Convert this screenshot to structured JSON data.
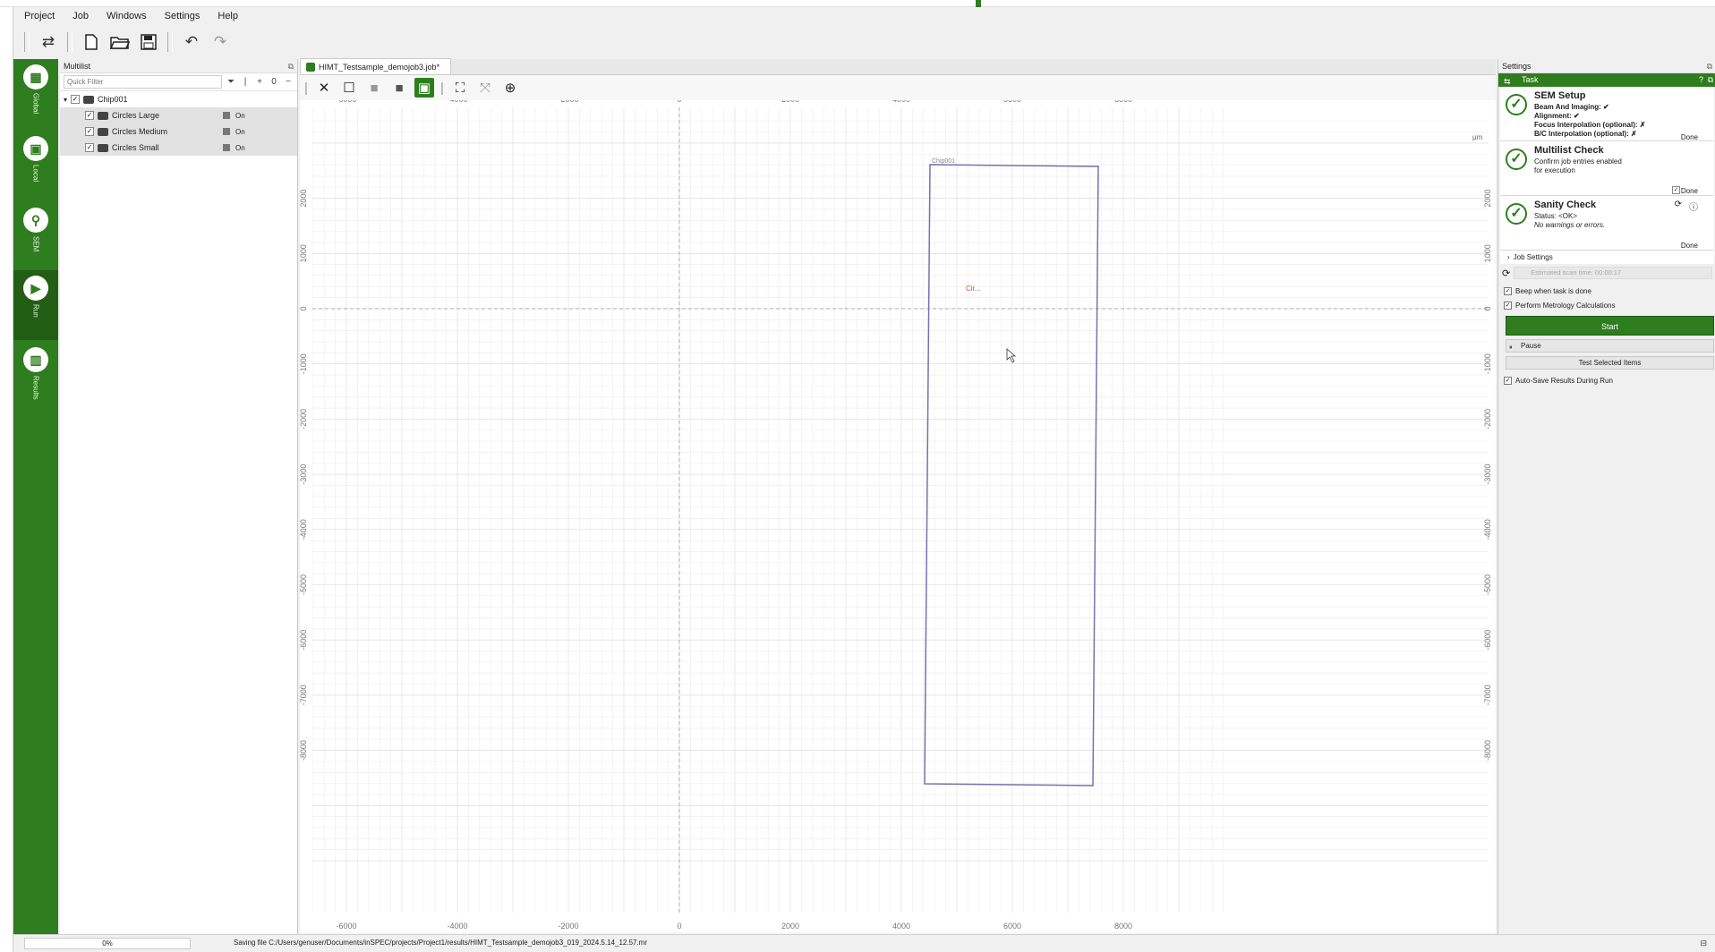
{
  "menubar": {
    "items": [
      "Project",
      "Job",
      "Windows",
      "Settings",
      "Help"
    ]
  },
  "toolbar": {
    "icons": [
      "swap-icon",
      "new-file-icon",
      "open-folder-icon",
      "save-icon",
      "undo-icon",
      "redo-icon"
    ]
  },
  "sidebar": {
    "items": [
      {
        "label": "Global",
        "icon": "global-icon"
      },
      {
        "label": "Local",
        "icon": "local-icon"
      },
      {
        "label": "SEM",
        "icon": "sem-icon"
      },
      {
        "label": "Run",
        "icon": "run-icon",
        "active": true
      },
      {
        "label": "Results",
        "icon": "results-icon"
      }
    ]
  },
  "multilist": {
    "title": "Multilist",
    "filter_placeholder": "Quick Filter",
    "counter": "0",
    "root": "Chip001",
    "items": [
      {
        "label": "Circles Large",
        "state": "On"
      },
      {
        "label": "Circles Medium",
        "state": "On"
      },
      {
        "label": "Circles Small",
        "state": "On"
      }
    ]
  },
  "job": {
    "tab_title": "HIMT_Testsample_demojob3.job*",
    "unit": "µm",
    "chip_label": "Chip001",
    "marker_label": "Cir..."
  },
  "canvas": {
    "x_ticks": [
      "-6000",
      "-4000",
      "-2000",
      "0",
      "2000",
      "4000",
      "6000",
      "8000"
    ],
    "y_ticks": [
      "2000",
      "1000",
      "0",
      "-1000",
      "-2000",
      "-3000",
      "-4000",
      "-5000",
      "-6000",
      "-7000",
      "-8000"
    ]
  },
  "settings": {
    "title": "Settings",
    "task_label": "Task",
    "sem_setup": {
      "title": "SEM Setup",
      "lines": [
        "Beam And Imaging: ✔",
        "Alignment: ✔",
        "Focus Interpolation (optional): ✗",
        "B/C Interpolation (optional): ✗"
      ],
      "done": "Done"
    },
    "multilist_check": {
      "title": "Multilist Check",
      "lines": [
        "Confirm job entries enabled",
        "for execution"
      ],
      "done": "Done"
    },
    "sanity_check": {
      "title": "Sanity Check",
      "status": "Status: <OK>",
      "note": "No warnings or errors.",
      "done": "Done"
    },
    "job_settings": "Job Settings",
    "estimated": "Estimated scan time: 00:00:17",
    "beep": "Beep when task is done",
    "metrology": "Perform Metrology Calculations",
    "start": "Start",
    "pause": "Pause",
    "test_selected": "Test Selected Items",
    "autosave": "Auto-Save Results During Run"
  },
  "status": {
    "progress": "0%",
    "message": "Saving file C:/Users/genuser/Documents/inSPEC/projects/Project1/results/HIMT_Testsample_demojob3_019_2024.5.14_12.57.mr"
  },
  "colors": {
    "accent": "#2e7d1e",
    "chip_outline": "#7a6fae",
    "marker": "#d0552a"
  }
}
